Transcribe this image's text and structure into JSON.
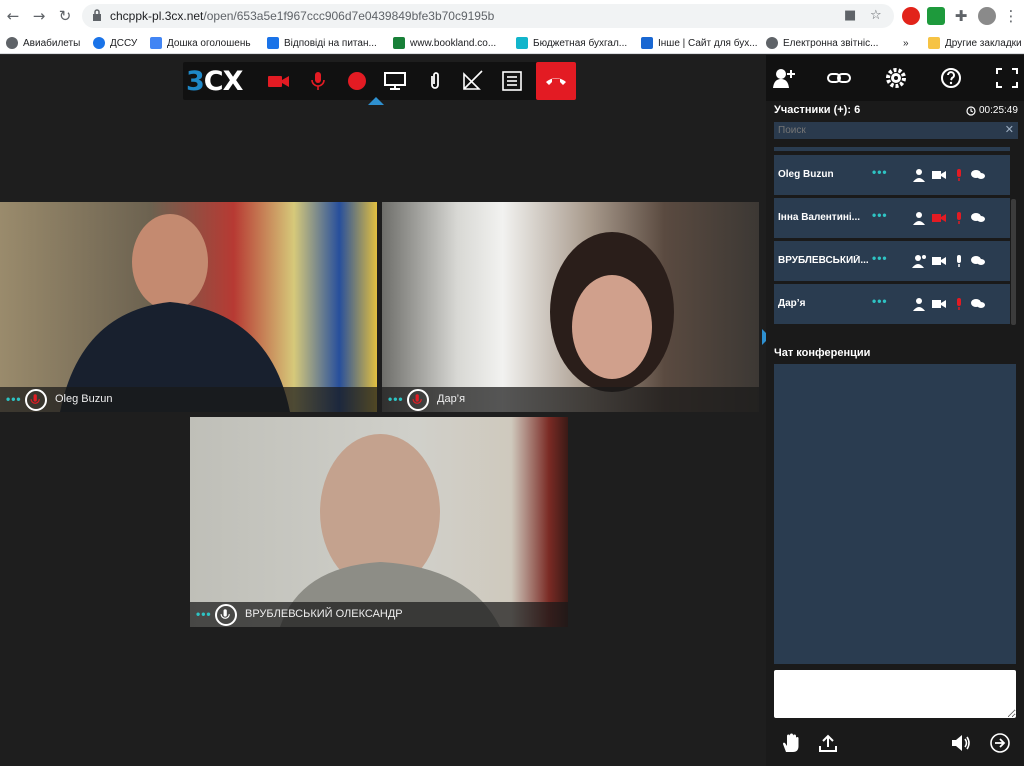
{
  "browser": {
    "back_icon": "back-arrow-icon",
    "url_host": "chcppk-pl.3cx.net",
    "url_path": "/open/653a5e1f967ccc906d7e0439849bfe3b70c9195b",
    "bookmarks": [
      {
        "label": "Авиабилеты",
        "color": "#5f6368"
      },
      {
        "label": "ДССУ",
        "color": "#1a73e8"
      },
      {
        "label": "Дошка оголошень",
        "color": "#4285f4"
      },
      {
        "label": "Відповіді на питан...",
        "color": "#1a73e8"
      },
      {
        "label": "www.bookland.co...",
        "color": "#188038"
      },
      {
        "label": "Бюджетная бухгал...",
        "color": "#12b5cb"
      },
      {
        "label": "Інше | Сайт для бух...",
        "color": "#1967d2"
      },
      {
        "label": "Електронна звітніс...",
        "color": "#5f6368"
      }
    ],
    "more_bookmarks": "»",
    "other_bookmarks": "Другие закладки"
  },
  "app": {
    "logo_3": "3",
    "logo_cx": "CX",
    "accent": "#1e88c8",
    "danger": "#e31b23"
  },
  "tiles": [
    {
      "name": "Oleg Buzun",
      "mic_muted": true
    },
    {
      "name": "Дар’я",
      "mic_muted": true
    },
    {
      "name": "ВРУБЛЕВСЬКИЙ ОЛЕКСАНДР",
      "mic_muted": false
    }
  ],
  "panel": {
    "participants_label": "Участники",
    "participants_plus": "(+): 6",
    "timer": "00:25:49",
    "search_placeholder": "Поиск",
    "participants": [
      {
        "name": "Oleg Buzun",
        "cam_off": false,
        "mic_muted": true
      },
      {
        "name": "Інна Валентині...",
        "cam_off": true,
        "mic_muted": true
      },
      {
        "name": "ВРУБЛЕВСЬКИЙ...",
        "cam_off": false,
        "mic_muted": false
      },
      {
        "name": "Дар’я",
        "cam_off": false,
        "mic_muted": true
      }
    ],
    "chat_label": "Чат конференции"
  }
}
